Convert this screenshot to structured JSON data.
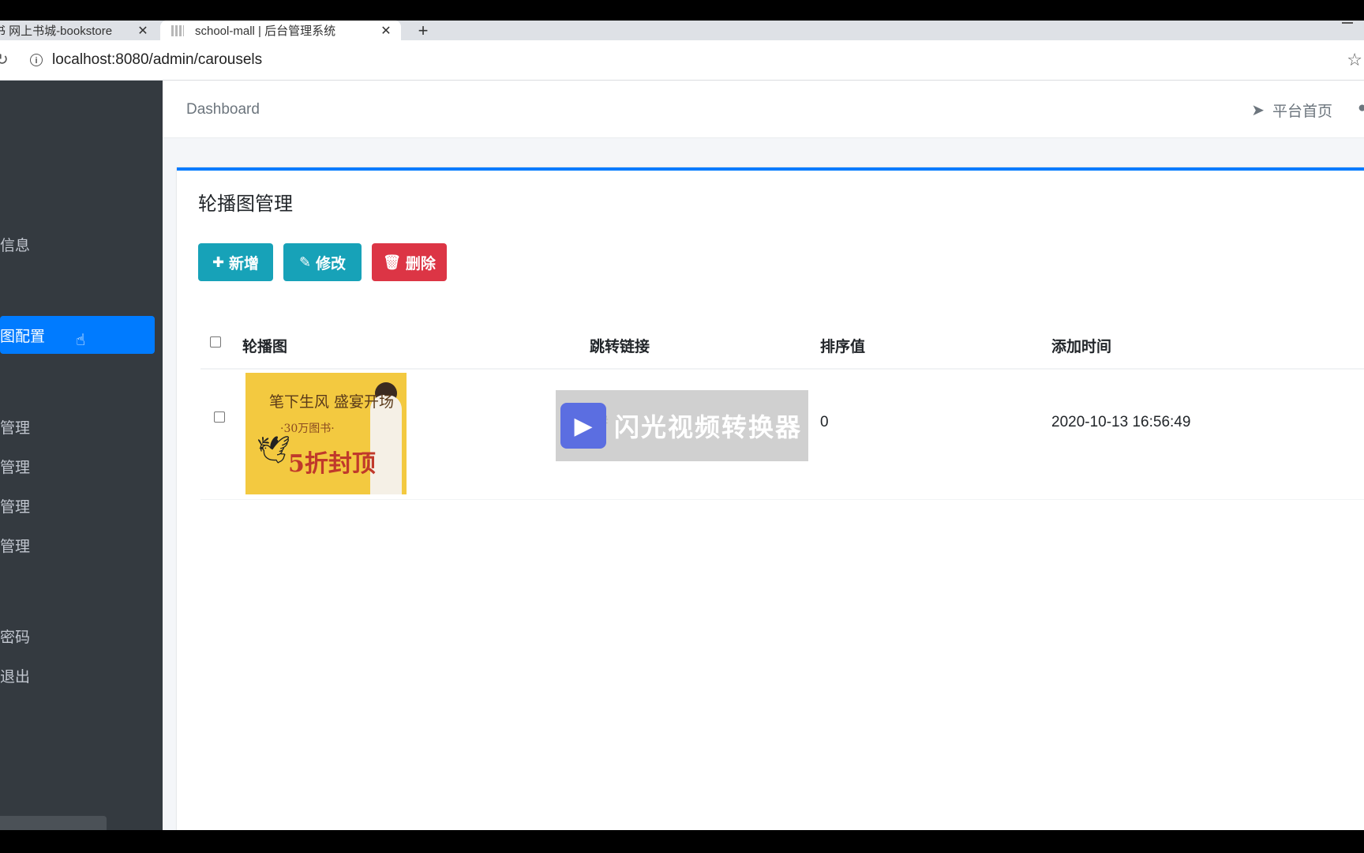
{
  "browser": {
    "tabs": [
      {
        "title": "书 网上书城-bookstore",
        "active": false
      },
      {
        "title": "school-mall | 后台管理系统",
        "active": true
      }
    ],
    "tab_close": "✕",
    "new_tab": "+",
    "url": "localhost:8080/admin/carousels"
  },
  "sidebar": {
    "items": [
      {
        "label": "信息",
        "active": false
      },
      {
        "label": "图配置",
        "active": true
      },
      {
        "label": "管理",
        "active": false
      },
      {
        "label": "管理",
        "active": false
      },
      {
        "label": "管理",
        "active": false
      },
      {
        "label": "管理",
        "active": false
      },
      {
        "label": "密码",
        "active": false
      },
      {
        "label": "退出",
        "active": false
      }
    ],
    "accent": "#007bff"
  },
  "navbar": {
    "breadcrumb": "Dashboard",
    "platform_home": "平台首页"
  },
  "card": {
    "title": "轮播图管理",
    "buttons": {
      "add": "新增",
      "edit": "修改",
      "delete": "删除"
    }
  },
  "table": {
    "columns": [
      "轮播图",
      "跳转链接",
      "排序值",
      "添加时间"
    ],
    "rows": [
      {
        "carousel_text": [
          "笔下生风 盛宴开场",
          "·30万图书·",
          "5折封顶"
        ],
        "link": "##",
        "sort": "0",
        "added": "2020-10-13 16:56:49"
      }
    ]
  },
  "watermark": {
    "text": "闪光视频转换器"
  },
  "colors": {
    "info": "#17a2b8",
    "danger": "#dc3545",
    "sidebar_bg": "#343a40"
  }
}
